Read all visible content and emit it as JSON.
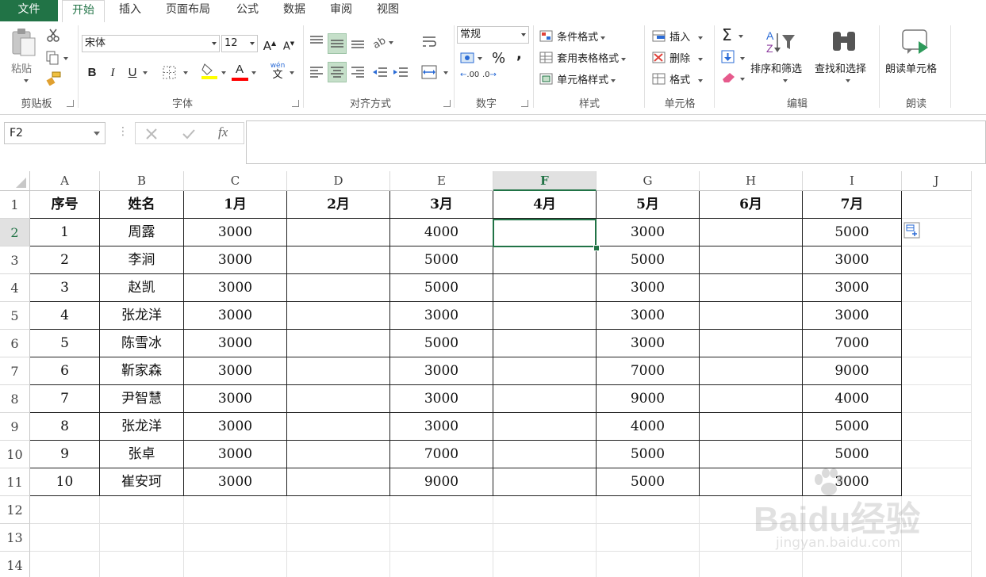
{
  "tabs": [
    "文件",
    "开始",
    "插入",
    "页面布局",
    "公式",
    "数据",
    "审阅",
    "视图"
  ],
  "ribbon": {
    "clipboard": {
      "paste": "粘贴",
      "label": "剪贴板"
    },
    "font": {
      "name": "宋体",
      "size": "12",
      "bold": "B",
      "italic": "I",
      "underline": "U",
      "font_color_letter": "A",
      "phonetic": "wén",
      "phonetic_char": "文",
      "grow": "A",
      "shrink": "A",
      "label": "字体",
      "highlight_color": "#ffff00",
      "text_color": "#ff0000"
    },
    "align": {
      "label": "对齐方式"
    },
    "number": {
      "format": "常规",
      "percent": "%",
      "comma": ",",
      "label": "数字",
      "inc_decimal": ".00",
      "dec_decimal": ".0"
    },
    "styles": {
      "conditional": "条件格式",
      "table": "套用表格格式",
      "cell": "单元格样式",
      "label": "样式"
    },
    "cells": {
      "insert": "插入",
      "delete": "删除",
      "format": "格式",
      "label": "单元格"
    },
    "editing": {
      "sort": "排序和筛选",
      "find": "查找和选择",
      "label": "编辑",
      "sum": "Σ"
    },
    "read": {
      "read_cell": "朗读单元格",
      "label": "朗读"
    }
  },
  "formula_bar": {
    "name_box": "F2",
    "fx": "fx",
    "value": ""
  },
  "columns": [
    "A",
    "B",
    "C",
    "D",
    "E",
    "F",
    "G",
    "H",
    "I",
    "J"
  ],
  "active_column": "F",
  "active_row": 2,
  "rows": [
    1,
    2,
    3,
    4,
    5,
    6,
    7,
    8,
    9,
    10,
    11,
    12,
    13,
    14
  ],
  "table": {
    "header": [
      "序号",
      "姓名",
      "1月",
      "2月",
      "3月",
      "4月",
      "5月",
      "6月",
      "7月"
    ],
    "data": [
      [
        "1",
        "周露",
        "3000",
        "",
        "4000",
        "",
        "3000",
        "",
        "5000"
      ],
      [
        "2",
        "李涧",
        "3000",
        "",
        "5000",
        "",
        "5000",
        "",
        "3000"
      ],
      [
        "3",
        "赵凯",
        "3000",
        "",
        "5000",
        "",
        "3000",
        "",
        "3000"
      ],
      [
        "4",
        "张龙洋",
        "3000",
        "",
        "3000",
        "",
        "3000",
        "",
        "3000"
      ],
      [
        "5",
        "陈雪冰",
        "3000",
        "",
        "5000",
        "",
        "3000",
        "",
        "7000"
      ],
      [
        "6",
        "靳家森",
        "3000",
        "",
        "3000",
        "",
        "7000",
        "",
        "9000"
      ],
      [
        "7",
        "尹智慧",
        "3000",
        "",
        "3000",
        "",
        "9000",
        "",
        "4000"
      ],
      [
        "8",
        "张龙洋",
        "3000",
        "",
        "3000",
        "",
        "4000",
        "",
        "5000"
      ],
      [
        "9",
        "张卓",
        "3000",
        "",
        "7000",
        "",
        "5000",
        "",
        "5000"
      ],
      [
        "10",
        "崔安珂",
        "3000",
        "",
        "9000",
        "",
        "5000",
        "",
        "3000"
      ]
    ]
  },
  "watermark": {
    "text": "Baidu经验",
    "url": "jingyan.baidu.com"
  },
  "colors": {
    "accent": "#217346",
    "selection": "#217346"
  }
}
